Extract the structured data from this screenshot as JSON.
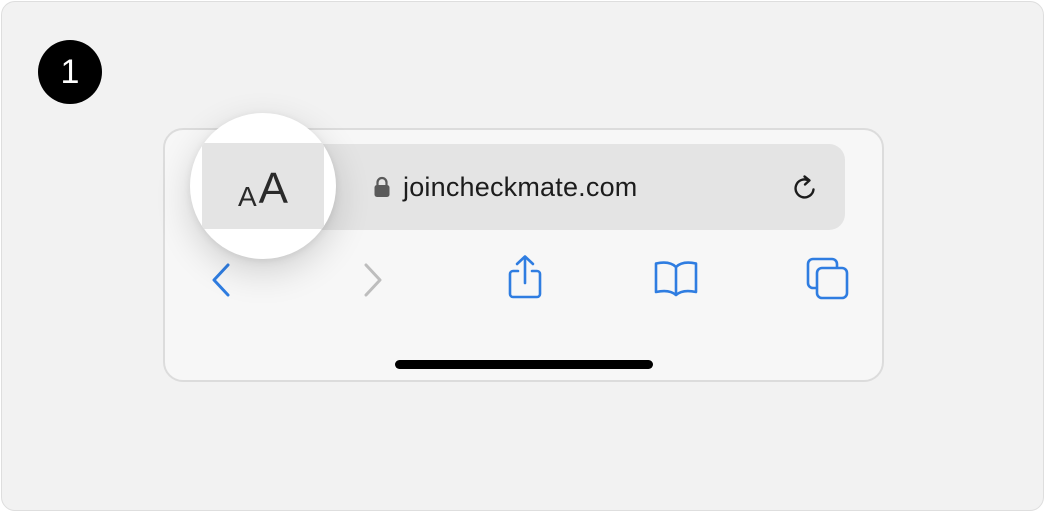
{
  "step": {
    "number": "1"
  },
  "address_bar": {
    "url": "joincheckmate.com",
    "text_size_small": "A",
    "text_size_large": "A"
  },
  "toolbar": {
    "back_icon": "chevron-left-icon",
    "forward_icon": "chevron-right-icon",
    "share_icon": "share-icon",
    "bookmarks_icon": "book-icon",
    "tabs_icon": "tabs-icon"
  },
  "colors": {
    "accent": "#2f7de1",
    "disabled": "#bdbdbd",
    "badge": "#000000"
  }
}
